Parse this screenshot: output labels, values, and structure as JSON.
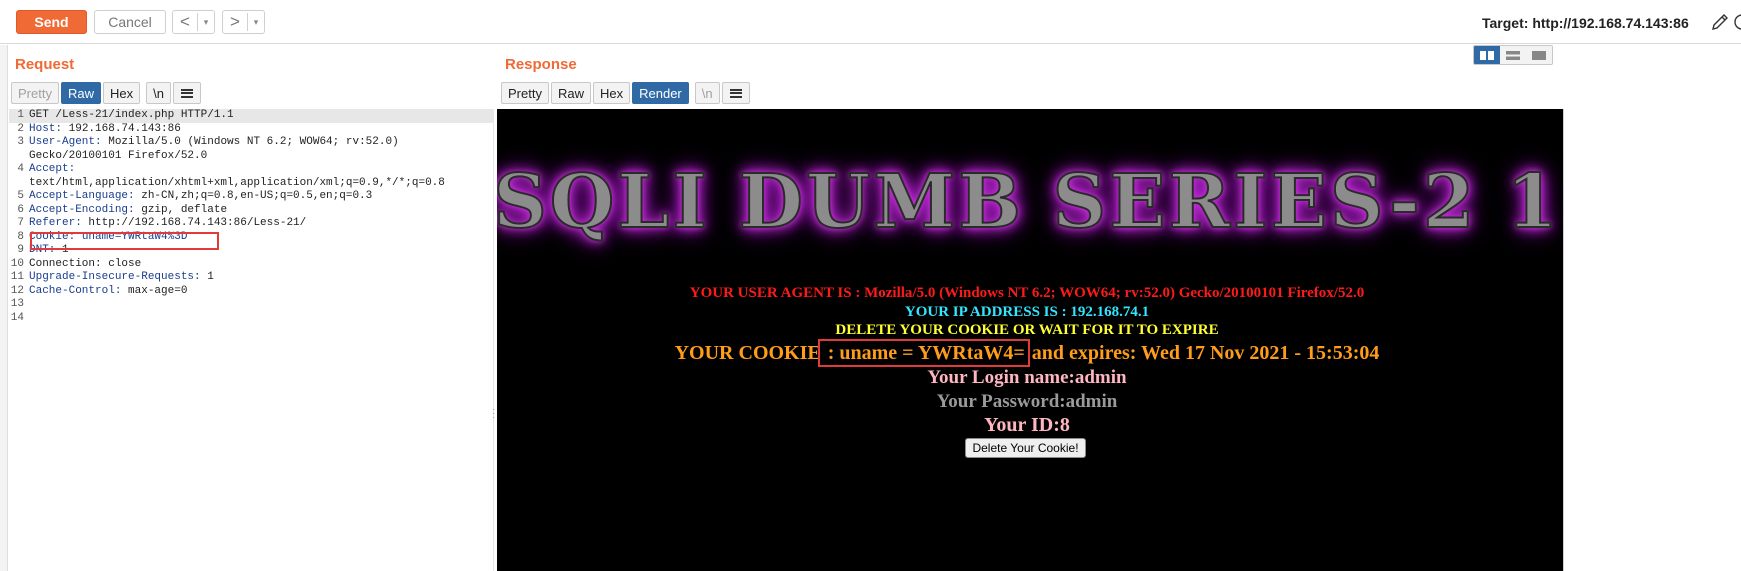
{
  "toolbar": {
    "send_label": "Send",
    "cancel_label": "Cancel",
    "back_arrow": "<",
    "forward_arrow": ">",
    "dropdown_arrow": "▾",
    "target_label": "Target:",
    "target_url": "http://192.168.74.143:86"
  },
  "request": {
    "title": "Request",
    "tabs": [
      "Pretty",
      "Raw",
      "Hex",
      "\\n"
    ],
    "active_tab": "Raw",
    "lines": [
      {
        "n": "1",
        "name": "",
        "text": "GET /Less-21/index.php HTTP/1.1"
      },
      {
        "n": "2",
        "name": "Host:",
        "text": " 192.168.74.143:86"
      },
      {
        "n": "3",
        "name": "User-Agent:",
        "text": " Mozilla/5.0 (Windows NT 6.2; WOW64; rv:52.0)"
      },
      {
        "n": "",
        "name": "",
        "text": "Gecko/20100101 Firefox/52.0"
      },
      {
        "n": "4",
        "name": "Accept:",
        "text": ""
      },
      {
        "n": "",
        "name": "",
        "text": "text/html,application/xhtml+xml,application/xml;q=0.9,*/*;q=0.8"
      },
      {
        "n": "5",
        "name": "Accept-Language:",
        "text": " zh-CN,zh;q=0.8,en-US;q=0.5,en;q=0.3"
      },
      {
        "n": "6",
        "name": "Accept-Encoding:",
        "text": " gzip, deflate"
      },
      {
        "n": "7",
        "name": "Referer:",
        "text": " http://192.168.74.143:86/Less-21/"
      },
      {
        "n": "8",
        "name": "Cookie:",
        "text": " uname=YWRtaW4%3D"
      },
      {
        "n": "9",
        "name": "DNT:",
        "text": " 1"
      },
      {
        "n": "10",
        "name": "",
        "text": "Connection: close"
      },
      {
        "n": "11",
        "name": "Upgrade-Insecure-Requests:",
        "text": " 1"
      },
      {
        "n": "12",
        "name": "Cache-Control:",
        "text": " max-age=0"
      },
      {
        "n": "13",
        "name": "",
        "text": ""
      },
      {
        "n": "14",
        "name": "",
        "text": ""
      }
    ]
  },
  "response": {
    "title": "Response",
    "tabs": [
      "Pretty",
      "Raw",
      "Hex",
      "Render",
      "\\n"
    ],
    "active_tab": "Render",
    "banner": "SQLI DUMB SERIES-2 1",
    "user_agent": "YOUR USER AGENT IS : Mozilla/5.0 (Windows NT 6.2; WOW64; rv:52.0) Gecko/20100101 Firefox/52.0",
    "ip": "YOUR IP ADDRESS IS : 192.168.74.1",
    "delete_msg": "DELETE YOUR COOKIE OR WAIT FOR IT TO EXPIRE",
    "cookie_prefix": "YOUR COOKIE",
    "cookie_value": " : uname = YWRtaW4=",
    "cookie_suffix": " and expires: Wed 17 Nov 2021 - 15:53:04",
    "login": "Your Login name:admin",
    "password": "Your Password:admin",
    "id": "Your ID:8",
    "delete_button": "Delete Your Cookie!"
  },
  "colors": {
    "accent": "#f06a35",
    "active_tab": "#2f6aa6",
    "highlight_box": "#e03a3a"
  }
}
